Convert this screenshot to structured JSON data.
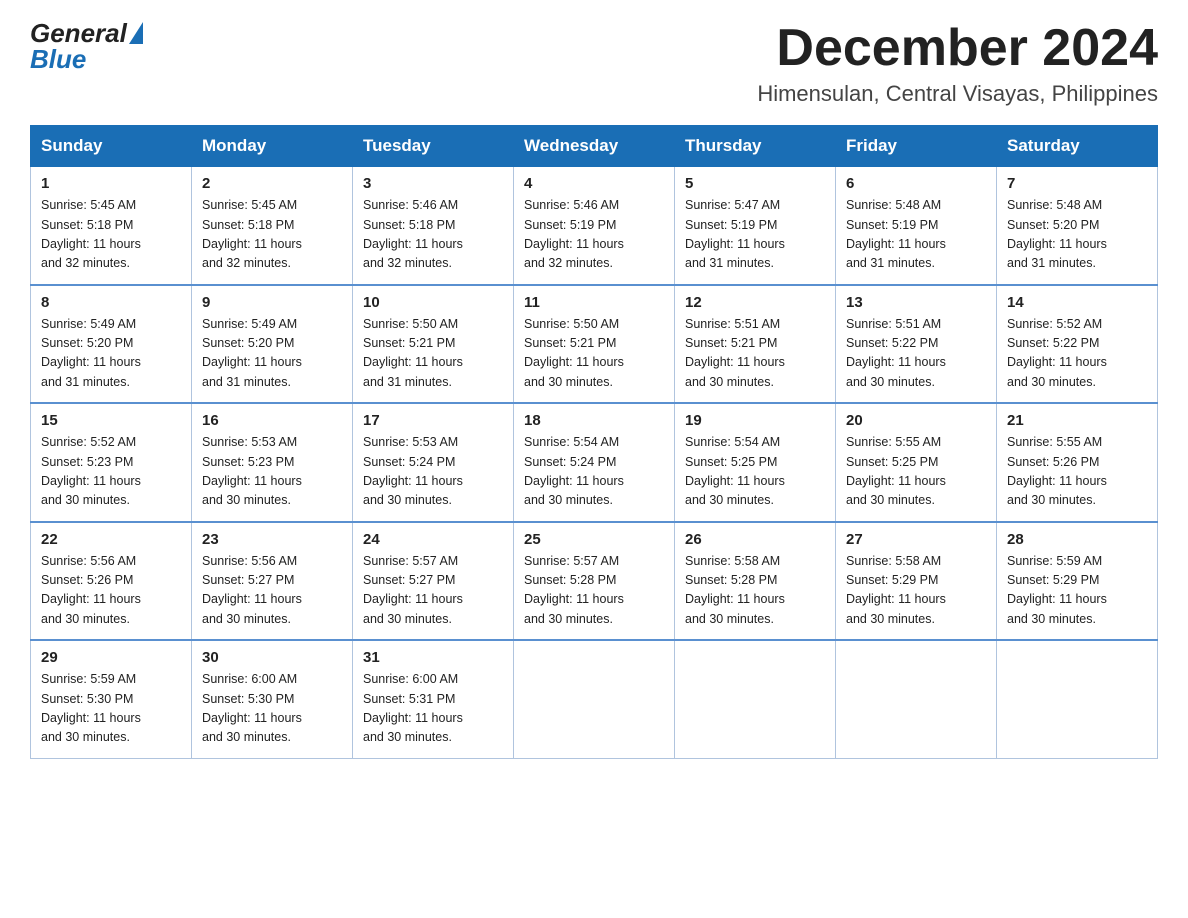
{
  "header": {
    "logo": {
      "general": "General",
      "blue": "Blue"
    },
    "month_title": "December 2024",
    "location": "Himensulan, Central Visayas, Philippines"
  },
  "days_of_week": [
    "Sunday",
    "Monday",
    "Tuesday",
    "Wednesday",
    "Thursday",
    "Friday",
    "Saturday"
  ],
  "weeks": [
    [
      {
        "day": "1",
        "sunrise": "5:45 AM",
        "sunset": "5:18 PM",
        "daylight": "11 hours and 32 minutes."
      },
      {
        "day": "2",
        "sunrise": "5:45 AM",
        "sunset": "5:18 PM",
        "daylight": "11 hours and 32 minutes."
      },
      {
        "day": "3",
        "sunrise": "5:46 AM",
        "sunset": "5:18 PM",
        "daylight": "11 hours and 32 minutes."
      },
      {
        "day": "4",
        "sunrise": "5:46 AM",
        "sunset": "5:19 PM",
        "daylight": "11 hours and 32 minutes."
      },
      {
        "day": "5",
        "sunrise": "5:47 AM",
        "sunset": "5:19 PM",
        "daylight": "11 hours and 31 minutes."
      },
      {
        "day": "6",
        "sunrise": "5:48 AM",
        "sunset": "5:19 PM",
        "daylight": "11 hours and 31 minutes."
      },
      {
        "day": "7",
        "sunrise": "5:48 AM",
        "sunset": "5:20 PM",
        "daylight": "11 hours and 31 minutes."
      }
    ],
    [
      {
        "day": "8",
        "sunrise": "5:49 AM",
        "sunset": "5:20 PM",
        "daylight": "11 hours and 31 minutes."
      },
      {
        "day": "9",
        "sunrise": "5:49 AM",
        "sunset": "5:20 PM",
        "daylight": "11 hours and 31 minutes."
      },
      {
        "day": "10",
        "sunrise": "5:50 AM",
        "sunset": "5:21 PM",
        "daylight": "11 hours and 31 minutes."
      },
      {
        "day": "11",
        "sunrise": "5:50 AM",
        "sunset": "5:21 PM",
        "daylight": "11 hours and 30 minutes."
      },
      {
        "day": "12",
        "sunrise": "5:51 AM",
        "sunset": "5:21 PM",
        "daylight": "11 hours and 30 minutes."
      },
      {
        "day": "13",
        "sunrise": "5:51 AM",
        "sunset": "5:22 PM",
        "daylight": "11 hours and 30 minutes."
      },
      {
        "day": "14",
        "sunrise": "5:52 AM",
        "sunset": "5:22 PM",
        "daylight": "11 hours and 30 minutes."
      }
    ],
    [
      {
        "day": "15",
        "sunrise": "5:52 AM",
        "sunset": "5:23 PM",
        "daylight": "11 hours and 30 minutes."
      },
      {
        "day": "16",
        "sunrise": "5:53 AM",
        "sunset": "5:23 PM",
        "daylight": "11 hours and 30 minutes."
      },
      {
        "day": "17",
        "sunrise": "5:53 AM",
        "sunset": "5:24 PM",
        "daylight": "11 hours and 30 minutes."
      },
      {
        "day": "18",
        "sunrise": "5:54 AM",
        "sunset": "5:24 PM",
        "daylight": "11 hours and 30 minutes."
      },
      {
        "day": "19",
        "sunrise": "5:54 AM",
        "sunset": "5:25 PM",
        "daylight": "11 hours and 30 minutes."
      },
      {
        "day": "20",
        "sunrise": "5:55 AM",
        "sunset": "5:25 PM",
        "daylight": "11 hours and 30 minutes."
      },
      {
        "day": "21",
        "sunrise": "5:55 AM",
        "sunset": "5:26 PM",
        "daylight": "11 hours and 30 minutes."
      }
    ],
    [
      {
        "day": "22",
        "sunrise": "5:56 AM",
        "sunset": "5:26 PM",
        "daylight": "11 hours and 30 minutes."
      },
      {
        "day": "23",
        "sunrise": "5:56 AM",
        "sunset": "5:27 PM",
        "daylight": "11 hours and 30 minutes."
      },
      {
        "day": "24",
        "sunrise": "5:57 AM",
        "sunset": "5:27 PM",
        "daylight": "11 hours and 30 minutes."
      },
      {
        "day": "25",
        "sunrise": "5:57 AM",
        "sunset": "5:28 PM",
        "daylight": "11 hours and 30 minutes."
      },
      {
        "day": "26",
        "sunrise": "5:58 AM",
        "sunset": "5:28 PM",
        "daylight": "11 hours and 30 minutes."
      },
      {
        "day": "27",
        "sunrise": "5:58 AM",
        "sunset": "5:29 PM",
        "daylight": "11 hours and 30 minutes."
      },
      {
        "day": "28",
        "sunrise": "5:59 AM",
        "sunset": "5:29 PM",
        "daylight": "11 hours and 30 minutes."
      }
    ],
    [
      {
        "day": "29",
        "sunrise": "5:59 AM",
        "sunset": "5:30 PM",
        "daylight": "11 hours and 30 minutes."
      },
      {
        "day": "30",
        "sunrise": "6:00 AM",
        "sunset": "5:30 PM",
        "daylight": "11 hours and 30 minutes."
      },
      {
        "day": "31",
        "sunrise": "6:00 AM",
        "sunset": "5:31 PM",
        "daylight": "11 hours and 30 minutes."
      },
      null,
      null,
      null,
      null
    ]
  ],
  "labels": {
    "sunrise": "Sunrise:",
    "sunset": "Sunset:",
    "daylight": "Daylight:"
  }
}
